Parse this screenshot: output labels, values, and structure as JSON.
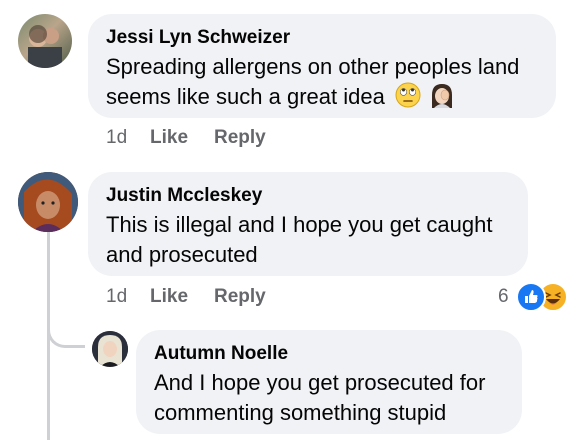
{
  "comments": [
    {
      "author": "Jessi Lyn Schweizer",
      "line1": "Spreading allergens on other peoples land",
      "line2": "seems like such a great idea",
      "time": "1d",
      "like": "Like",
      "reply": "Reply",
      "emojis": [
        "eye-roll-emoji",
        "woman-facepalm-emoji"
      ]
    },
    {
      "author": "Justin Mccleskey",
      "line1": "This is illegal and I hope you get caught",
      "line2": "and prosecuted",
      "time": "1d",
      "like": "Like",
      "reply": "Reply",
      "reaction_count": "6",
      "reactions": [
        "like-reaction-icon",
        "haha-reaction-icon"
      ]
    },
    {
      "author": "Autumn Noelle",
      "line1": "And I hope you get prosecuted for",
      "line2": "commenting something stupid"
    }
  ],
  "colors": {
    "bubble": "#f0f2f5",
    "secondary_text": "#65676b",
    "like_blue": "#1877f2",
    "haha_yellow": "#f7b125",
    "thread_line": "#ced0d4"
  }
}
